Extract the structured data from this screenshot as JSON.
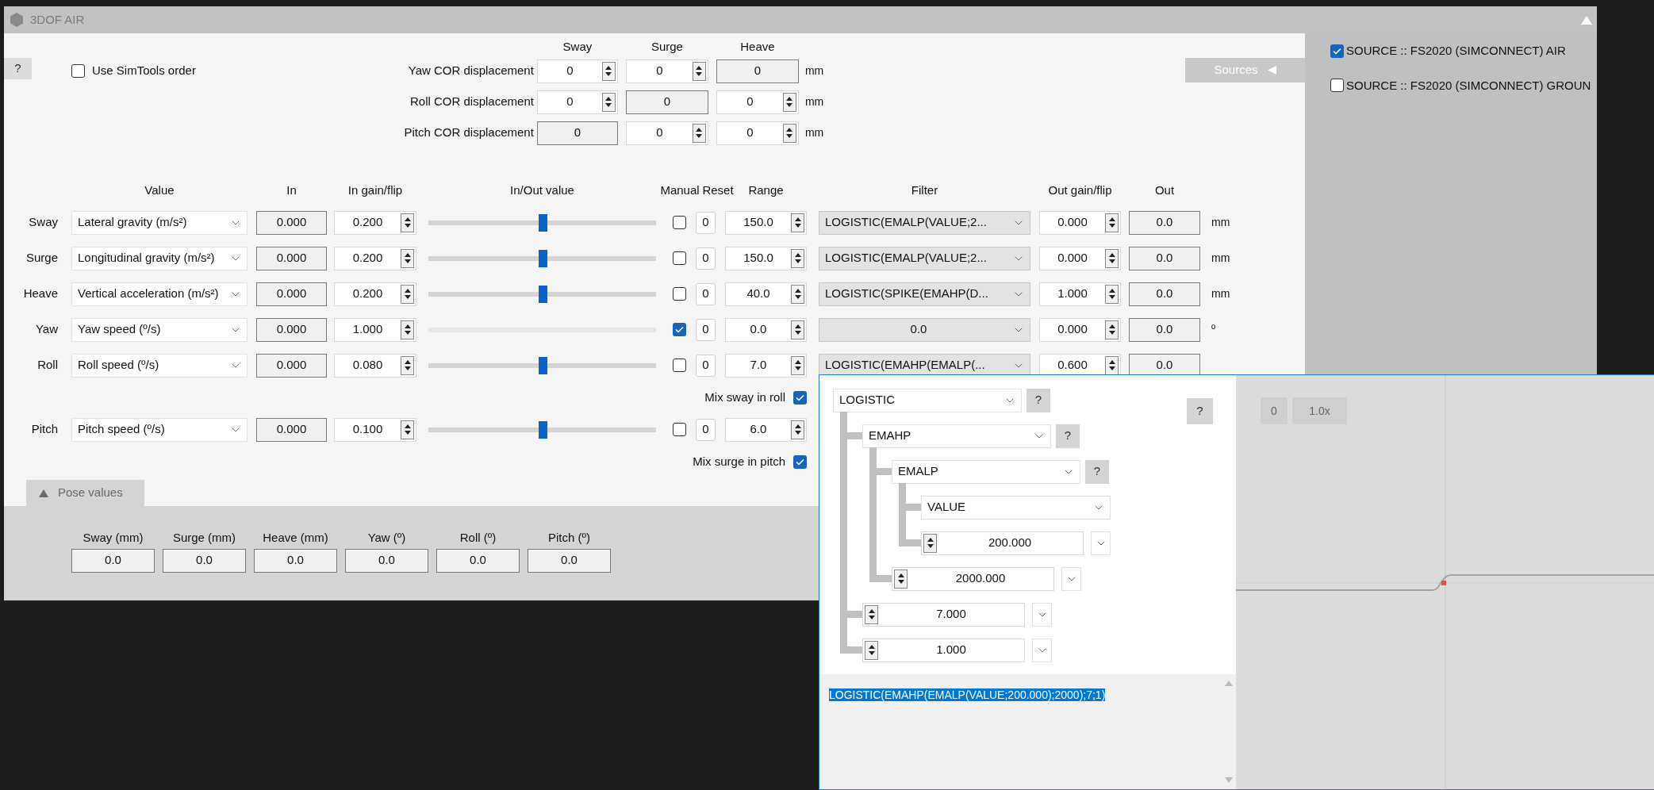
{
  "window": {
    "title": "3DOF AIR"
  },
  "help_button": "?",
  "use_simtools_order": {
    "label": "Use SimTools order",
    "checked": false
  },
  "cor": {
    "columns": [
      "Sway",
      "Surge",
      "Heave"
    ],
    "rows": [
      {
        "label": "Yaw COR displacement",
        "unit": "mm",
        "cells": [
          {
            "value": "0",
            "editable": true
          },
          {
            "value": "0",
            "editable": true
          },
          {
            "value": "0",
            "editable": false
          }
        ]
      },
      {
        "label": "Roll COR displacement",
        "unit": "mm",
        "cells": [
          {
            "value": "0",
            "editable": true
          },
          {
            "value": "0",
            "editable": false
          },
          {
            "value": "0",
            "editable": true
          }
        ]
      },
      {
        "label": "Pitch COR displacement",
        "unit": "mm",
        "cells": [
          {
            "value": "0",
            "editable": false
          },
          {
            "value": "0",
            "editable": true
          },
          {
            "value": "0",
            "editable": true
          }
        ]
      }
    ]
  },
  "sources_tab": "Sources",
  "sources": [
    {
      "label": "SOURCE :: FS2020 (SIMCONNECT) AIR",
      "checked": true
    },
    {
      "label": "SOURCE :: FS2020 (SIMCONNECT) GROUN",
      "checked": false
    }
  ],
  "table": {
    "columns": [
      "Value",
      "In",
      "In gain/flip",
      "In/Out value",
      "Manual",
      "Reset",
      "Range",
      "Filter",
      "Out gain/flip",
      "Out"
    ],
    "rows": [
      {
        "label": "Sway",
        "value": "Lateral gravity (m/s²)",
        "in": "0.000",
        "in_gain": "0.200",
        "slider_disabled": false,
        "level": 0.5,
        "manual": false,
        "reset": "0",
        "range": "150.0",
        "filter": "LOGISTIC(EMALP(VALUE;2...",
        "out_gain": "0.000",
        "out": "0.0",
        "unit": "mm"
      },
      {
        "label": "Surge",
        "value": "Longitudinal gravity (m/s²)",
        "in": "0.000",
        "in_gain": "0.200",
        "slider_disabled": false,
        "level": 0.5,
        "manual": false,
        "reset": "0",
        "range": "150.0",
        "filter": "LOGISTIC(EMALP(VALUE;2...",
        "out_gain": "0.000",
        "out": "0.0",
        "unit": "mm"
      },
      {
        "label": "Heave",
        "value": "Vertical acceleration (m/s²)",
        "in": "0.000",
        "in_gain": "0.200",
        "slider_disabled": false,
        "level": 0.5,
        "manual": false,
        "reset": "0",
        "range": "40.0",
        "filter": "LOGISTIC(SPIKE(EMAHP(D...",
        "out_gain": "1.000",
        "out": "0.0",
        "unit": "mm"
      },
      {
        "label": "Yaw",
        "value": "Yaw speed (º/s)",
        "in": "0.000",
        "in_gain": "1.000",
        "slider_disabled": true,
        "manual": true,
        "reset": "0",
        "range": "0.0",
        "filter": "0.0",
        "out_gain": "0.000",
        "out": "0.0",
        "unit": "º"
      },
      {
        "label": "Roll",
        "value": "Roll speed (º/s)",
        "in": "0.000",
        "in_gain": "0.080",
        "slider_disabled": false,
        "level": 0.5,
        "manual": false,
        "reset": "0",
        "range": "7.0",
        "filter": "LOGISTIC(EMAHP(EMALP(...",
        "out_gain": "0.600",
        "out": "0.0",
        "mix": {
          "label": "Mix sway in roll",
          "checked": true
        }
      },
      {
        "label": "Pitch",
        "value": "Pitch speed (º/s)",
        "in": "0.000",
        "in_gain": "0.100",
        "slider_disabled": false,
        "level": 0.5,
        "manual": false,
        "reset": "0",
        "range": "6.0",
        "mix": {
          "label": "Mix surge in pitch",
          "checked": true
        }
      }
    ]
  },
  "pose": {
    "tab": "Pose values",
    "fields": [
      {
        "label": "Sway (mm)",
        "value": "0.0"
      },
      {
        "label": "Surge (mm)",
        "value": "0.0"
      },
      {
        "label": "Heave (mm)",
        "value": "0.0"
      },
      {
        "label": "Yaw (º)",
        "value": "0.0"
      },
      {
        "label": "Roll (º)",
        "value": "0.0"
      },
      {
        "label": "Pitch (º)",
        "value": "0.0"
      }
    ]
  },
  "filter_editor": {
    "help_button": "?",
    "tree": {
      "kind": "function",
      "value": "LOGISTIC",
      "help": "?",
      "children": [
        {
          "kind": "function",
          "value": "EMAHP",
          "help": "?",
          "children": [
            {
              "kind": "function",
              "value": "EMALP",
              "help": "?",
              "children": [
                {
                  "kind": "input",
                  "value": "VALUE"
                },
                {
                  "kind": "number",
                  "value": "200.000"
                }
              ]
            },
            {
              "kind": "number",
              "value": "2000.000"
            }
          ]
        },
        {
          "kind": "number",
          "value": "7.000"
        },
        {
          "kind": "number",
          "value": "1.000"
        }
      ]
    },
    "expression": {
      "text": "LOGISTIC(EMAHP(EMALP(VALUE;200.000);2000);7;1)",
      "selected": true
    },
    "graph_buttons": [
      "0",
      "1.0x"
    ]
  }
}
